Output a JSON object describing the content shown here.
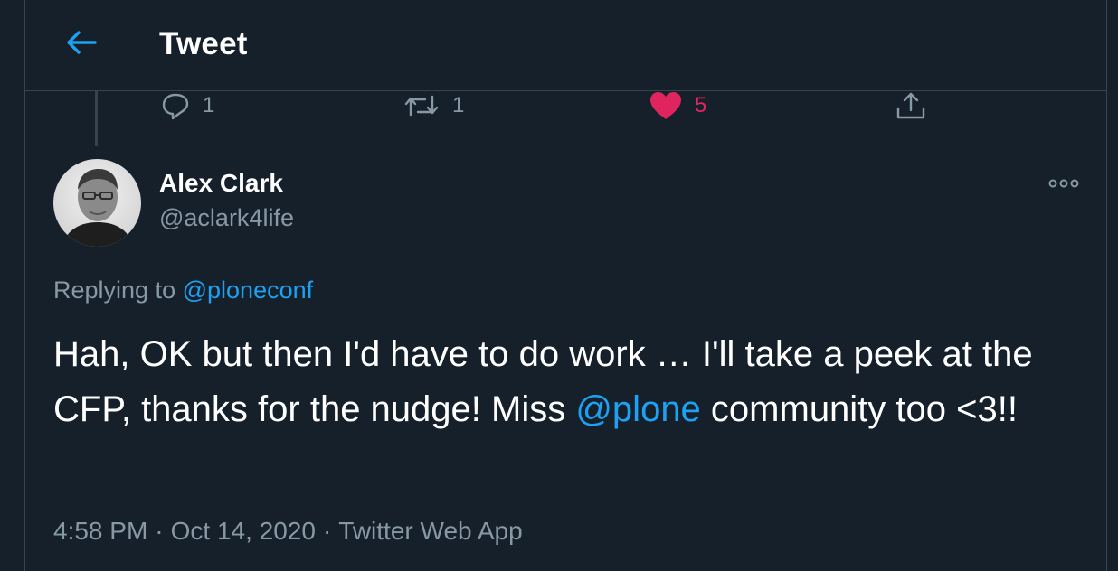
{
  "header": {
    "title": "Tweet"
  },
  "actions": {
    "reply_count": "1",
    "retweet_count": "1",
    "like_count": "5"
  },
  "tweet": {
    "author_name": "Alex Clark",
    "author_handle": "@aclark4life",
    "replying_prefix": "Replying to",
    "replying_to": "@ploneconf",
    "text_part1": "Hah, OK but then I'd have to do work … I'll take a peek at the CFP, thanks for the nudge! Miss ",
    "mention": "@plone",
    "text_part2": " community too <3!!",
    "time": "4:58 PM",
    "date": "Oct 14, 2020",
    "source": "Twitter Web App"
  },
  "colors": {
    "background": "#15202b",
    "border": "#38444d",
    "accent": "#1da1f2",
    "like": "#e0245e",
    "secondary_text": "#8899a6"
  }
}
